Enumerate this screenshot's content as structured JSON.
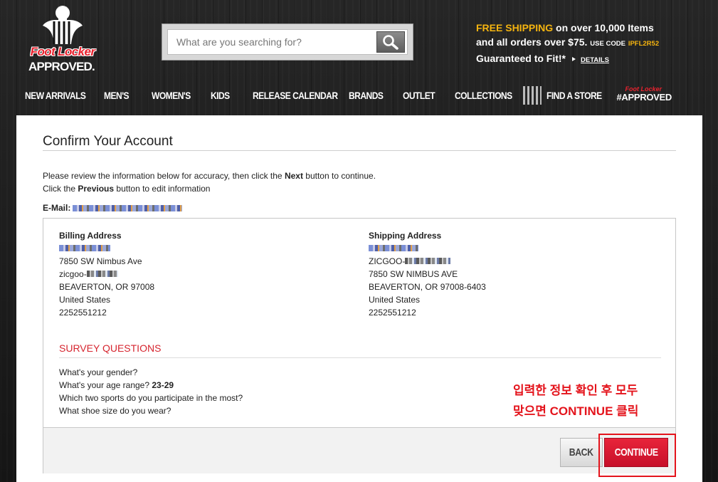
{
  "header": {
    "logo_brand": "Foot Locker",
    "logo_approved": "APPROVED.",
    "search_placeholder": "What are you searching for?",
    "promo": {
      "free_shipping": "FREE SHIPPING",
      "line1_rest": " on over 10,000 Items",
      "line2": "and all orders over $75.",
      "use_code_label": "USE CODE",
      "code": "IPFL2R52",
      "line3": "Guaranteed to Fit!*",
      "details": "DETAILS"
    },
    "accent": "#f5b40f",
    "brand_red": "#e8222e"
  },
  "nav": {
    "items": [
      "NEW ARRIVALS",
      "MEN'S",
      "WOMEN'S",
      "KIDS",
      "RELEASE CALENDAR",
      "BRANDS",
      "OUTLET",
      "COLLECTIONS"
    ],
    "find_store": "FIND A STORE",
    "approved_small": "Foot Locker",
    "approved_tag": "#APPROVED"
  },
  "page": {
    "title": "Confirm Your Account",
    "intro_1a": "Please review the information below for accuracy, then click the ",
    "intro_1b": "Next",
    "intro_1c": " button to continue.",
    "intro_2a": "Click the ",
    "intro_2b": "Previous",
    "intro_2c": " button to edit information",
    "email_label": "E-Mail:"
  },
  "billing": {
    "heading": "Billing Address",
    "street": "7850 SW Nimbus Ave",
    "line3_prefix": "zicgoo-",
    "city": "BEAVERTON, OR 97008",
    "country": "United States",
    "phone": "2252551212"
  },
  "shipping": {
    "heading": "Shipping Address",
    "line2_prefix": "ZICGOO-",
    "street": "7850 SW NIMBUS AVE",
    "city": "BEAVERTON, OR 97008-6403",
    "country": "United States",
    "phone": "2252551212"
  },
  "survey": {
    "title": "SURVEY QUESTIONS",
    "q1": "What's your gender?",
    "q2": "What's your age range?",
    "q2_answer": "23-29",
    "q3": "Which two sports do you participate in the most?",
    "q4": "What shoe size do you wear?"
  },
  "annotation": {
    "line1": "입력한 정보 확인 후 모두",
    "line2": "맞으면 CONTINUE 클릭",
    "color": "#e4141c"
  },
  "buttons": {
    "back": "BACK",
    "continue": "CONTINUE"
  }
}
